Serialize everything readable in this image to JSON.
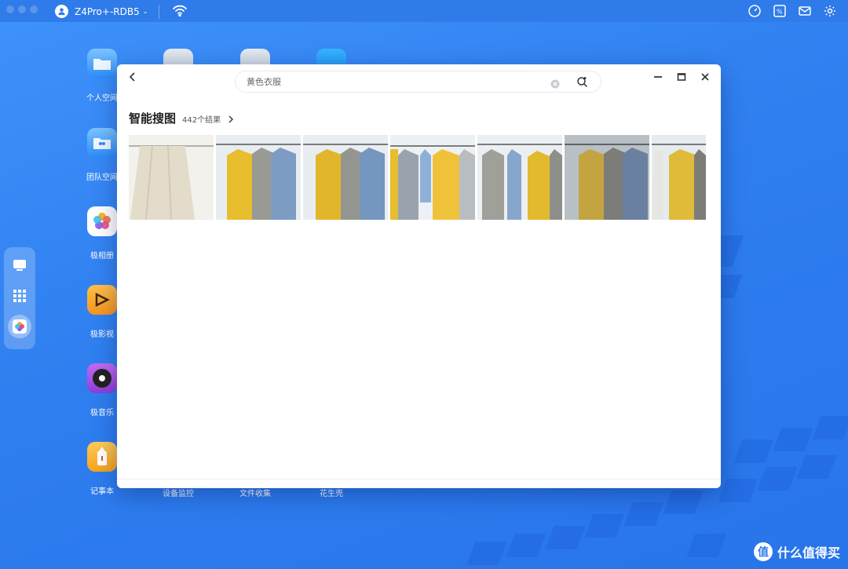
{
  "topbar": {
    "device_name": "Z4Pro+-RDB5",
    "right_icons": [
      "speedometer-icon",
      "percent-icon",
      "mail-icon",
      "gear-icon"
    ]
  },
  "dock": {
    "items": [
      "monitor-icon",
      "apps-grid-icon",
      "photos-icon"
    ]
  },
  "desktop": {
    "apps": [
      {
        "label": "个人空间"
      },
      {
        "label": "团队空间"
      },
      {
        "label": "极相册"
      },
      {
        "label": "极影视"
      },
      {
        "label": "极音乐"
      },
      {
        "label": "记事本"
      },
      {
        "label": "设备监控"
      },
      {
        "label": "文件收集"
      },
      {
        "label": "花生壳"
      }
    ]
  },
  "window": {
    "search_value": "黄色衣服",
    "section_title": "智能搜图",
    "result_count": "442个结果",
    "thumbnails": [
      "fabric-photo",
      "clothes-rack-photo",
      "clothes-rack-photo",
      "clothes-rack-photo",
      "clothes-rack-photo",
      "clothes-rack-photo",
      "clothes-rack-photo"
    ]
  },
  "brand": {
    "logo_text": "什么值得买",
    "logo_mark": "值"
  },
  "colors": {
    "desktop": "#2f7ff0",
    "yellow_coat": "#e6be2e",
    "shirt_blue": "#7d9cc4"
  }
}
